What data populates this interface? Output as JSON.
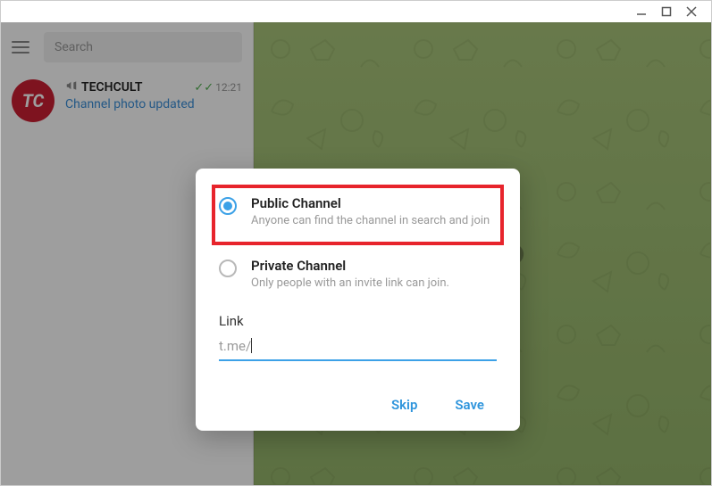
{
  "titlebar": {
    "minimize": "Minimize",
    "maximize": "Maximize",
    "close": "Close"
  },
  "sidebar": {
    "search_placeholder": "Search",
    "chat": {
      "avatar_text": "TC",
      "name": "TECHCULT",
      "time": "12:21",
      "preview": "Channel photo updated"
    }
  },
  "main": {
    "background_hint": "messaging"
  },
  "modal": {
    "options": [
      {
        "title": "Public Channel",
        "desc": "Anyone can find the channel in search and join",
        "selected": true
      },
      {
        "title": "Private Channel",
        "desc": "Only people with an invite link can join.",
        "selected": false
      }
    ],
    "link_label": "Link",
    "link_prefix": "t.me/",
    "link_value": "",
    "skip_label": "Skip",
    "save_label": "Save"
  }
}
